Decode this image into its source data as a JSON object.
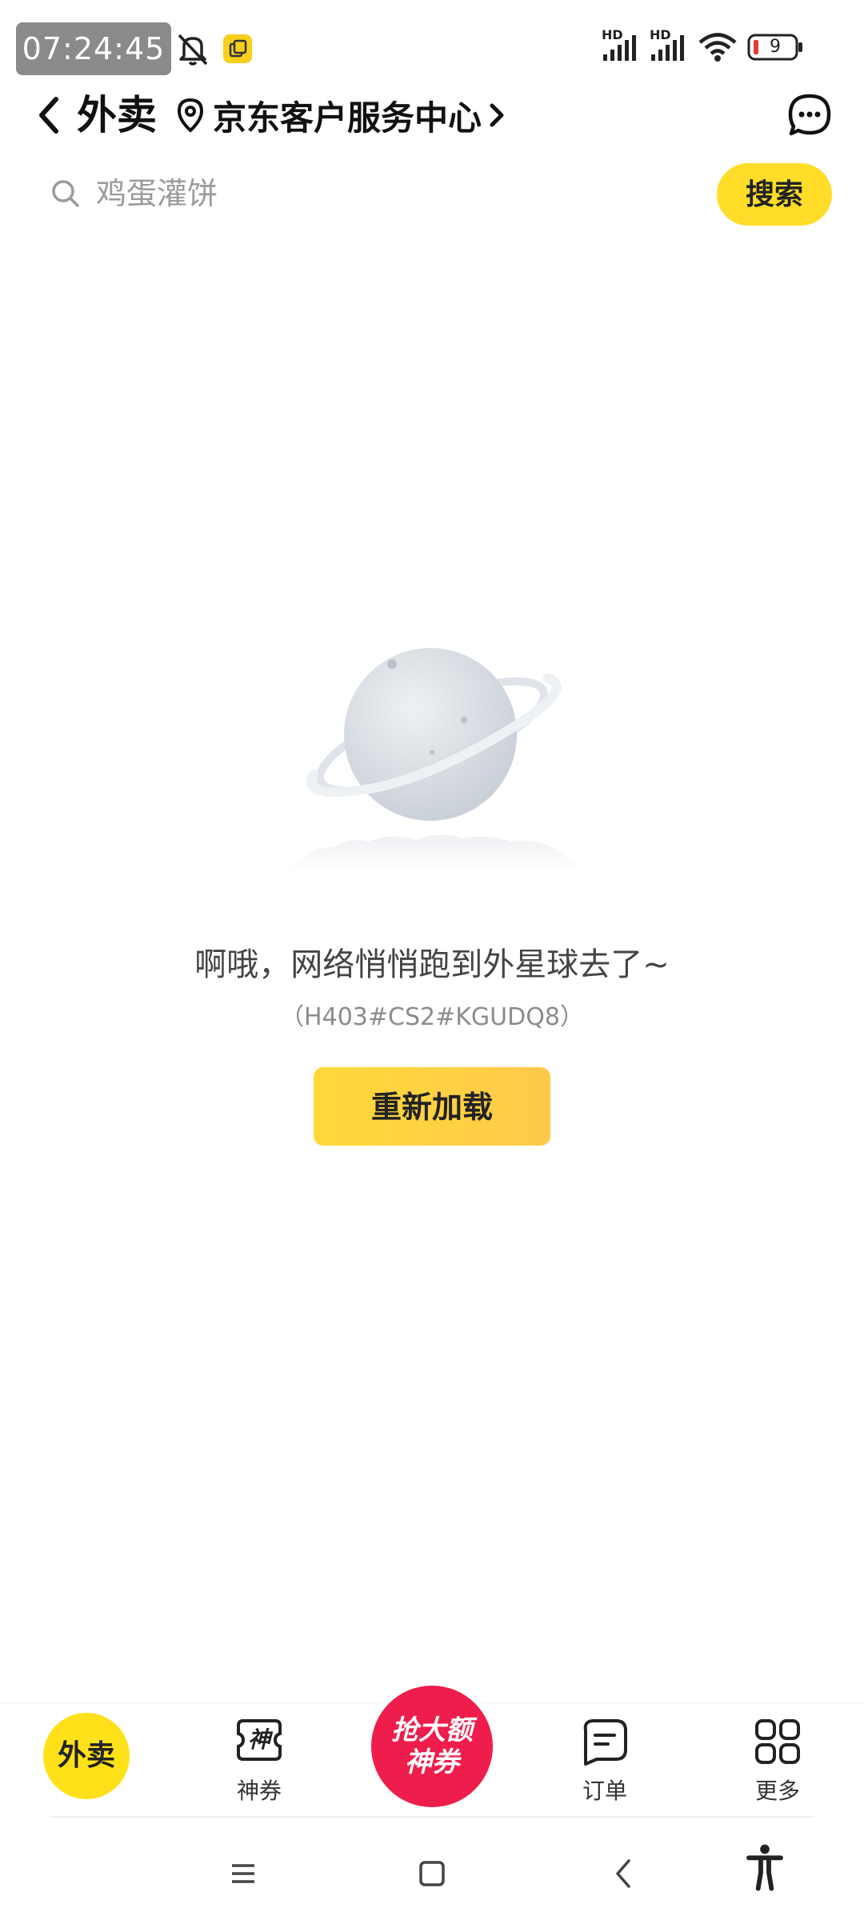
{
  "status_bar": {
    "time": "07:24:45",
    "battery_level": "9",
    "network_labels": [
      "HD",
      "HD"
    ],
    "icons": [
      "alarm-off-icon",
      "clipboard-icon",
      "signal-icon",
      "signal-icon",
      "wifi-icon",
      "battery-icon"
    ]
  },
  "header": {
    "title": "外卖",
    "location": "京东客户服务中心",
    "icons": [
      "back-arrow-icon",
      "location-pin-icon",
      "chevron-right-icon",
      "message-icon"
    ]
  },
  "search": {
    "placeholder": "鸡蛋灌饼",
    "button_label": "搜索",
    "icon": "search-icon"
  },
  "error": {
    "message": "啊哦，网络悄悄跑到外星球去了~",
    "code": "（H403#CS2#KGUDQ8）",
    "reload_label": "重新加载",
    "illustration": "planet-icon"
  },
  "bottom_nav": {
    "home_label": "外卖",
    "coupon_label": "神券",
    "coupon_icon_text": "神",
    "promo_line1": "抢大额",
    "promo_line2": "神券",
    "orders_label": "订单",
    "more_label": "更多",
    "icons": [
      "coupon-icon",
      "orders-icon",
      "more-grid-icon"
    ]
  },
  "system_nav": {
    "buttons": [
      "menu-icon",
      "home-square-icon",
      "back-icon",
      "accessibility-icon"
    ]
  },
  "colors": {
    "accent_yellow": "#ffdd29",
    "promo_red": "#ee1d4b",
    "text_primary": "#111111",
    "text_secondary": "#8c8c8c"
  }
}
